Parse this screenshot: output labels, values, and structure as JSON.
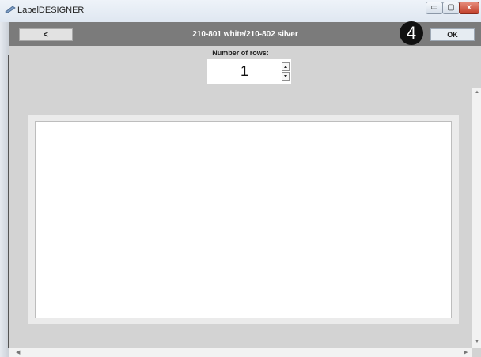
{
  "window": {
    "title": "LabelDESIGNER",
    "minimize_glyph": "▭",
    "maximize_glyph": "▢",
    "close_glyph": "x",
    "app_icon": "pen-icon"
  },
  "toolbar": {
    "back_label": "<",
    "title": "210-801 white/210-802 silver",
    "step_badge": "4",
    "ok_label": "OK"
  },
  "rows": {
    "label": "Number of rows:",
    "value": "1",
    "up_icon": "spin-up-icon",
    "down_icon": "spin-down-icon"
  },
  "label_layout": {
    "cells": [
      "top-left",
      "top-right",
      "middle",
      "bottom"
    ]
  },
  "scrollbars": {
    "up_arrow": "▲",
    "down_arrow": "▼",
    "left_arrow": "◀",
    "right_arrow": "▶"
  },
  "colors": {
    "toolbar_bg": "#7b7b7b",
    "canvas_bg": "#d3d3d3",
    "close_button": "#c3412c"
  }
}
